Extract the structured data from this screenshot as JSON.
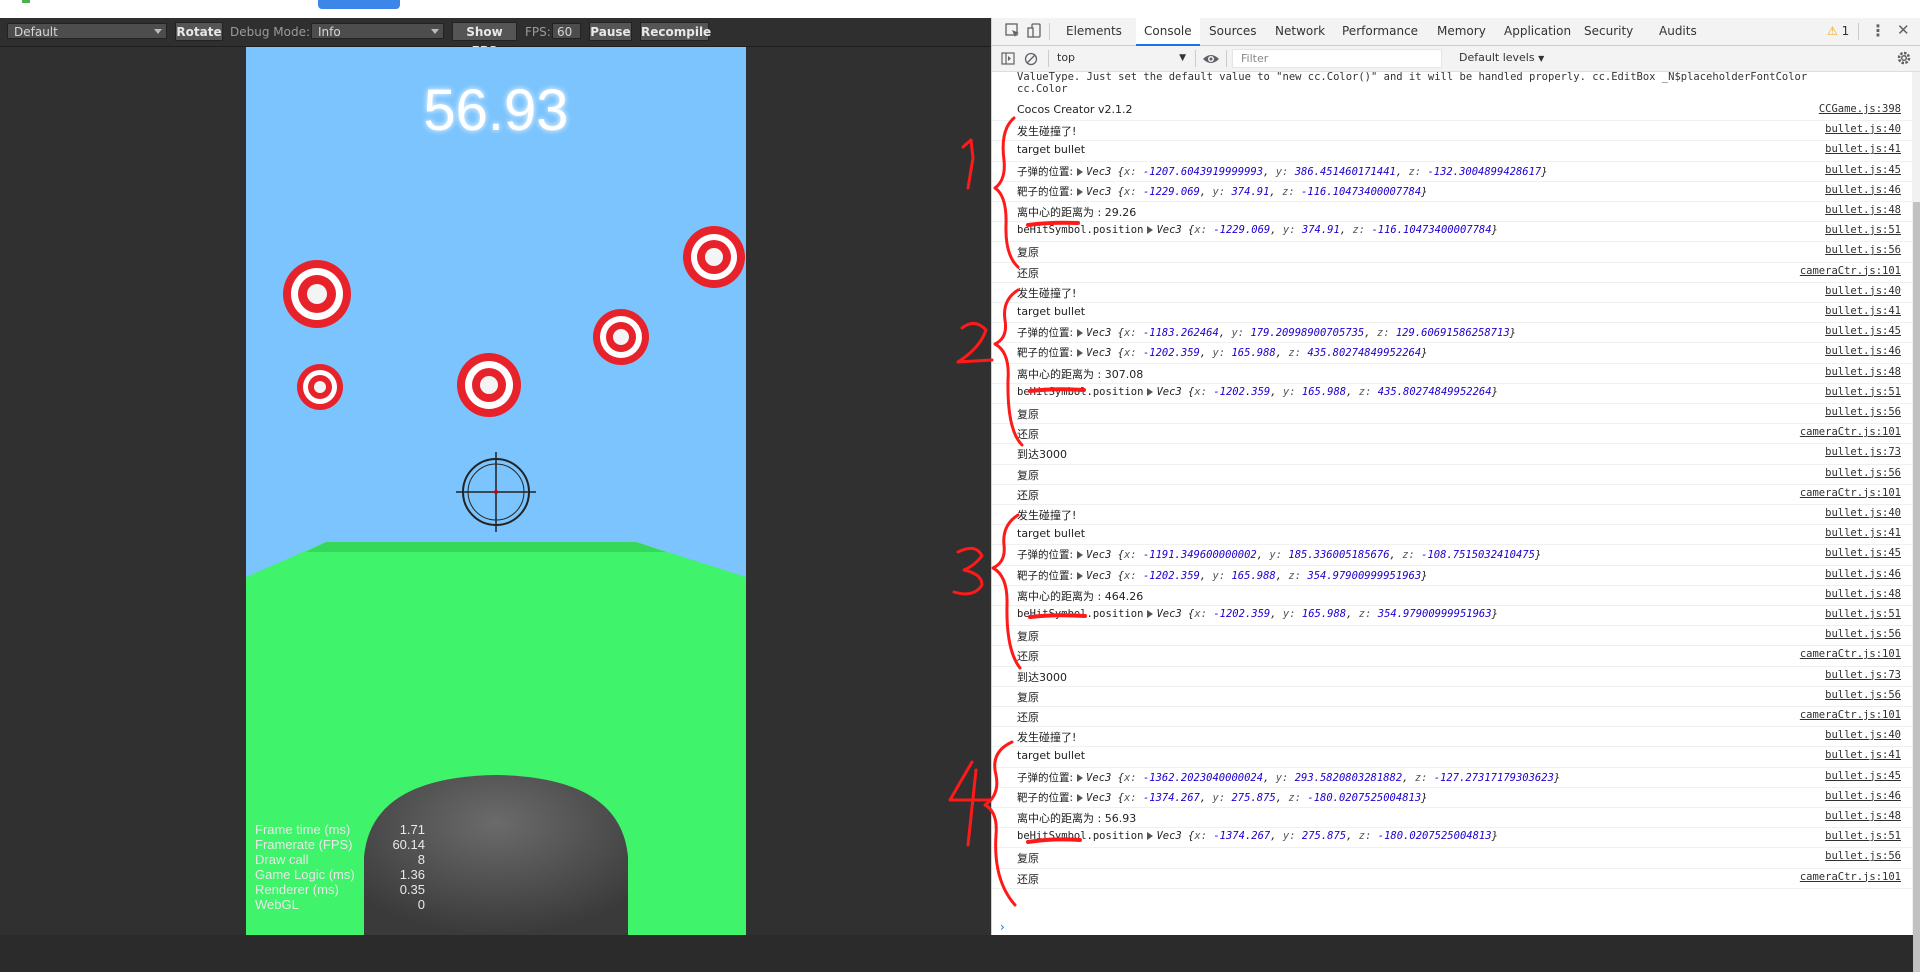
{
  "preview": {
    "toolbar": {
      "device_select": "Default",
      "rotate_label": "Rotate",
      "debug_mode_label": "Debug Mode:",
      "debug_mode_value": "Info",
      "show_fps_label": "Show FPS",
      "fps_label": "FPS:",
      "fps_value": "60",
      "pause_label": "Pause",
      "recompile_label": "Recompile"
    },
    "game": {
      "score": "56.93",
      "stats": [
        {
          "label": "Frame time (ms)",
          "value": "1.71"
        },
        {
          "label": "Framerate (FPS)",
          "value": "60.14"
        },
        {
          "label": "Draw call",
          "value": "8"
        },
        {
          "label": "Game Logic (ms)",
          "value": "1.36"
        },
        {
          "label": "Renderer (ms)",
          "value": "0.35"
        },
        {
          "label": "WebGL",
          "value": "0"
        }
      ]
    }
  },
  "devtools": {
    "tabs": [
      "Elements",
      "Console",
      "Sources",
      "Network",
      "Performance",
      "Memory",
      "Application",
      "Security",
      "Audits"
    ],
    "active_tab": "Console",
    "warning_count": "1",
    "context": "top",
    "filter_placeholder": "Filter",
    "levels": "Default levels",
    "console": {
      "truncated_line1": "ValueType. Just set the default value to \"new cc.Color()\" and it will be handled properly. cc.EditBox _N$placeholderFontColor",
      "truncated_line2": "cc.Color",
      "rows": [
        {
          "type": "text",
          "text": "Cocos Creator v2.1.2",
          "src": "CCGame.js:398"
        },
        {
          "type": "text",
          "text": "发生碰撞了!",
          "src": "bullet.js:40"
        },
        {
          "type": "text",
          "text": "target bullet",
          "src": "bullet.js:41"
        },
        {
          "type": "vec",
          "label": "子弹的位置:",
          "x": "-1207.6043919999993",
          "y": "386.451460171441",
          "z": "-132.3004899428617",
          "src": "bullet.js:45"
        },
        {
          "type": "vec",
          "label": "靶子的位置:",
          "x": "-1229.069",
          "y": "374.91",
          "z": "-116.10473400007784",
          "src": "bullet.js:46"
        },
        {
          "type": "text",
          "text": "离中心的距离为 : 29.26",
          "src": "bullet.js:48"
        },
        {
          "type": "vec",
          "label": "beHitSymbol.position",
          "x": "-1229.069",
          "y": "374.91",
          "z": "-116.10473400007784",
          "src": "bullet.js:51"
        },
        {
          "type": "text",
          "text": "复原",
          "src": "bullet.js:56"
        },
        {
          "type": "text",
          "text": "还原",
          "src": "cameraCtr.js:101"
        },
        {
          "type": "text",
          "text": "发生碰撞了!",
          "src": "bullet.js:40"
        },
        {
          "type": "text",
          "text": "target bullet",
          "src": "bullet.js:41"
        },
        {
          "type": "vec",
          "label": "子弹的位置:",
          "x": "-1183.262464",
          "y": "179.20998900705735",
          "z": "129.60691586258713",
          "src": "bullet.js:45"
        },
        {
          "type": "vec",
          "label": "靶子的位置:",
          "x": "-1202.359",
          "y": "165.988",
          "z": "435.80274849952264",
          "src": "bullet.js:46"
        },
        {
          "type": "text",
          "text": "离中心的距离为 : 307.08",
          "src": "bullet.js:48"
        },
        {
          "type": "vec",
          "label": "beHitSymbol.position",
          "x": "-1202.359",
          "y": "165.988",
          "z": "435.80274849952264",
          "src": "bullet.js:51"
        },
        {
          "type": "text",
          "text": "复原",
          "src": "bullet.js:56"
        },
        {
          "type": "text",
          "text": "还原",
          "src": "cameraCtr.js:101"
        },
        {
          "type": "text",
          "text": "到达3000",
          "src": "bullet.js:73"
        },
        {
          "type": "text",
          "text": "复原",
          "src": "bullet.js:56"
        },
        {
          "type": "text",
          "text": "还原",
          "src": "cameraCtr.js:101"
        },
        {
          "type": "text",
          "text": "发生碰撞了!",
          "src": "bullet.js:40"
        },
        {
          "type": "text",
          "text": "target bullet",
          "src": "bullet.js:41"
        },
        {
          "type": "vec",
          "label": "子弹的位置:",
          "x": "-1191.349600000002",
          "y": "185.336005185676",
          "z": "-108.7515032410475",
          "src": "bullet.js:45"
        },
        {
          "type": "vec",
          "label": "靶子的位置:",
          "x": "-1202.359",
          "y": "165.988",
          "z": "354.97900999951963",
          "src": "bullet.js:46"
        },
        {
          "type": "text",
          "text": "离中心的距离为 : 464.26",
          "src": "bullet.js:48"
        },
        {
          "type": "vec",
          "label": "beHitSymbol.position",
          "x": "-1202.359",
          "y": "165.988",
          "z": "354.97900999951963",
          "src": "bullet.js:51"
        },
        {
          "type": "text",
          "text": "复原",
          "src": "bullet.js:56"
        },
        {
          "type": "text",
          "text": "还原",
          "src": "cameraCtr.js:101"
        },
        {
          "type": "text",
          "text": "到达3000",
          "src": "bullet.js:73"
        },
        {
          "type": "text",
          "text": "复原",
          "src": "bullet.js:56"
        },
        {
          "type": "text",
          "text": "还原",
          "src": "cameraCtr.js:101"
        },
        {
          "type": "text",
          "text": "发生碰撞了!",
          "src": "bullet.js:40"
        },
        {
          "type": "text",
          "text": "target bullet",
          "src": "bullet.js:41"
        },
        {
          "type": "vec",
          "label": "子弹的位置:",
          "x": "-1362.2023040000024",
          "y": "293.5820803281882",
          "z": "-127.27317179303623",
          "src": "bullet.js:45"
        },
        {
          "type": "vec",
          "label": "靶子的位置:",
          "x": "-1374.267",
          "y": "275.875",
          "z": "-180.0207525004813",
          "src": "bullet.js:46"
        },
        {
          "type": "text",
          "text": "离中心的距离为 : 56.93",
          "src": "bullet.js:48"
        },
        {
          "type": "vec",
          "label": "beHitSymbol.position",
          "x": "-1374.267",
          "y": "275.875",
          "z": "-180.0207525004813",
          "src": "bullet.js:51"
        },
        {
          "type": "text",
          "text": "复原",
          "src": "bullet.js:56"
        },
        {
          "type": "text",
          "text": "还原",
          "src": "cameraCtr.js:101"
        }
      ]
    }
  },
  "colors": {
    "sky": "#7cc4fd",
    "ground": "#3ff36a",
    "target_red": "#e8222a",
    "annotation_red": "#ff1a1a",
    "link_blue": "#1c00cf"
  }
}
